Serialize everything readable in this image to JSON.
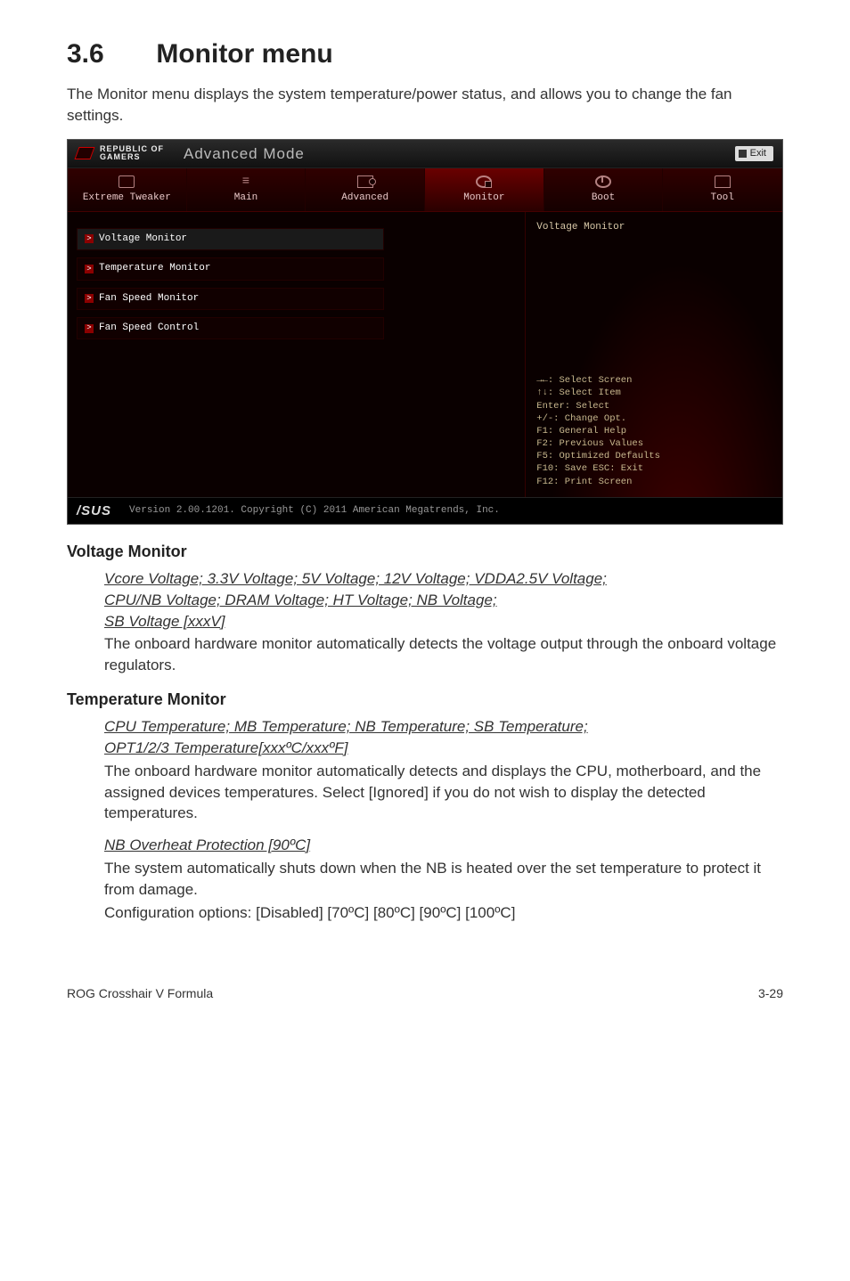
{
  "section": {
    "number": "3.6",
    "title": "Monitor menu"
  },
  "intro": "The Monitor menu displays the system temperature/power status, and allows you to change the fan settings.",
  "bios": {
    "brand_l1": "REPUBLIC OF",
    "brand_l2": "GAMERS",
    "mode": "Advanced Mode",
    "exit": "Exit",
    "tabs": {
      "tweaker": "Extreme Tweaker",
      "main": "Main",
      "advanced": "Advanced",
      "monitor": "Monitor",
      "boot": "Boot",
      "tool": "Tool"
    },
    "left_items": [
      "Voltage Monitor",
      "Temperature Monitor",
      "Fan Speed Monitor",
      "Fan Speed Control"
    ],
    "right_title": "Voltage Monitor",
    "help": [
      "→←: Select Screen",
      "↑↓: Select Item",
      "Enter: Select",
      "+/-: Change Opt.",
      "F1: General Help",
      "F2: Previous Values",
      "F5: Optimized Defaults",
      "F10: Save  ESC: Exit",
      "F12: Print Screen"
    ],
    "footer_brand": "/SUS",
    "footer_text": "Version 2.00.1201. Copyright (C) 2011 American Megatrends, Inc."
  },
  "voltage": {
    "heading": "Voltage Monitor",
    "lines": [
      "Vcore Voltage; 3.3V Voltage; 5V Voltage; 12V Voltage; VDDA2.5V Voltage;",
      "CPU/NB Voltage; DRAM Voltage; HT Voltage; NB Voltage;",
      "SB Voltage [xxxV]"
    ],
    "body": "The onboard hardware monitor automatically detects the voltage output through the onboard voltage regulators."
  },
  "temperature": {
    "heading": "Temperature Monitor",
    "item1_lines": [
      "CPU Temperature; MB Temperature; NB Temperature; SB Temperature;",
      "OPT1/2/3 Temperature[xxxºC/xxxºF]"
    ],
    "item1_body": "The onboard hardware monitor automatically detects and displays the CPU, motherboard, and the assigned devices temperatures. Select [Ignored] if you do not wish to display the detected temperatures.",
    "item2_line": "NB Overheat Protection [90ºC]",
    "item2_body1": "The system automatically shuts down when the NB is heated over the set temperature to protect it from damage.",
    "item2_body2": "Configuration options: [Disabled] [70ºC] [80ºC] [90ºC] [100ºC]"
  },
  "footer": {
    "left": "ROG Crosshair V Formula",
    "right": "3-29"
  },
  "chart_data": null
}
